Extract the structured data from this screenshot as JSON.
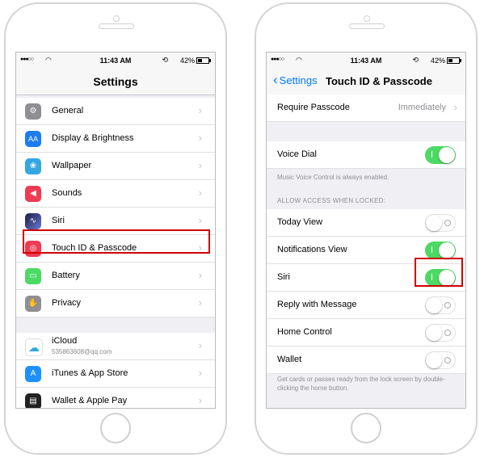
{
  "status_bar": {
    "signal": "●●●○○",
    "time": "11:43 AM",
    "battery": "42%"
  },
  "left_screen": {
    "title": "Settings",
    "group1": [
      {
        "label": "General",
        "icon": "gear-icon",
        "color": "#8e8e93"
      },
      {
        "label": "Display & Brightness",
        "icon": "display-icon",
        "color": "#1e7cf2"
      },
      {
        "label": "Wallpaper",
        "icon": "wallpaper-icon",
        "color": "#35a7e0"
      },
      {
        "label": "Sounds",
        "icon": "speaker-icon",
        "color": "#ef3b53"
      },
      {
        "label": "Siri",
        "icon": "siri-icon",
        "color": "#2c2d5e"
      },
      {
        "label": "Touch ID & Passcode",
        "icon": "fingerprint-icon",
        "color": "#ef3b53"
      },
      {
        "label": "Battery",
        "icon": "battery-icon",
        "color": "#4cd964"
      },
      {
        "label": "Privacy",
        "icon": "hand-icon",
        "color": "#8e8e93"
      }
    ],
    "group2": [
      {
        "label": "iCloud",
        "sublabel": "535863608@qq.com",
        "icon": "cloud-icon",
        "color": "#ffffff"
      },
      {
        "label": "iTunes & App Store",
        "icon": "app-store-icon",
        "color": "#1e90ff"
      },
      {
        "label": "Wallet & Apple Pay",
        "icon": "wallet-icon",
        "color": "#222222"
      }
    ]
  },
  "right_screen": {
    "back_label": "Settings",
    "title": "Touch ID & Passcode",
    "require_passcode": {
      "label": "Require Passcode",
      "value": "Immediately"
    },
    "voice_dial": {
      "label": "Voice Dial",
      "on": true
    },
    "voice_footer": "Music Voice Control is always enabled.",
    "locked_header": "ALLOW ACCESS WHEN LOCKED:",
    "locked_items": [
      {
        "label": "Today View",
        "on": false
      },
      {
        "label": "Notifications View",
        "on": true
      },
      {
        "label": "Siri",
        "on": true
      },
      {
        "label": "Reply with Message",
        "on": false
      },
      {
        "label": "Home Control",
        "on": false
      },
      {
        "label": "Wallet",
        "on": false
      }
    ],
    "wallet_footer": "Get cards or passes ready from the lock screen by double-clicking the home button."
  },
  "colors": {
    "accent": "#007aff",
    "toggle_on": "#4cd964",
    "highlight": "#d10000"
  }
}
